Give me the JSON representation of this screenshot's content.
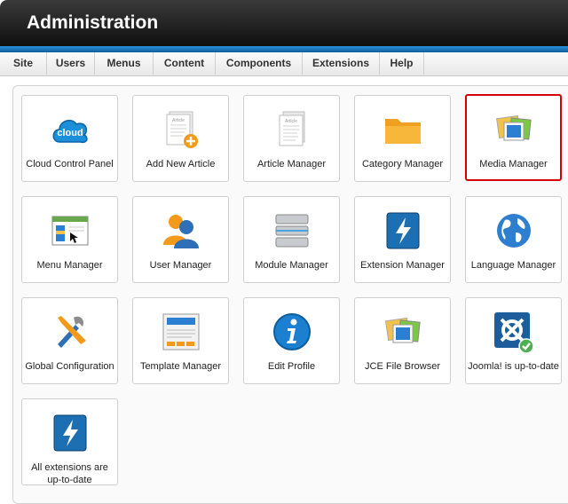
{
  "header": {
    "title": "Administration"
  },
  "menu": [
    "Site",
    "Users",
    "Menus",
    "Content",
    "Components",
    "Extensions",
    "Help"
  ],
  "tiles": [
    {
      "label": "Cloud Control Panel",
      "icon": "cloud-icon",
      "cloud_text": "cloud"
    },
    {
      "label": "Add New Article",
      "icon": "add-article-icon",
      "doc_word": "Article"
    },
    {
      "label": "Article Manager",
      "icon": "article-manager-icon",
      "doc_word": "Article"
    },
    {
      "label": "Category Manager",
      "icon": "folder-icon"
    },
    {
      "label": "Media Manager",
      "icon": "media-icon",
      "selected": true
    },
    {
      "label": "Menu Manager",
      "icon": "menu-window-icon"
    },
    {
      "label": "User Manager",
      "icon": "users-icon"
    },
    {
      "label": "Module Manager",
      "icon": "module-icon"
    },
    {
      "label": "Extension Manager",
      "icon": "extension-icon"
    },
    {
      "label": "Language Manager",
      "icon": "globe-icon"
    },
    {
      "label": "Global Configuration",
      "icon": "tools-icon"
    },
    {
      "label": "Template Manager",
      "icon": "template-icon"
    },
    {
      "label": "Edit Profile",
      "icon": "info-icon"
    },
    {
      "label": "JCE File Browser",
      "icon": "file-browser-icon"
    },
    {
      "label": "Joomla! is up-to-date",
      "icon": "joomla-check-icon"
    },
    {
      "label": "All extensions are up-to-date",
      "icon": "extension-icon"
    }
  ]
}
